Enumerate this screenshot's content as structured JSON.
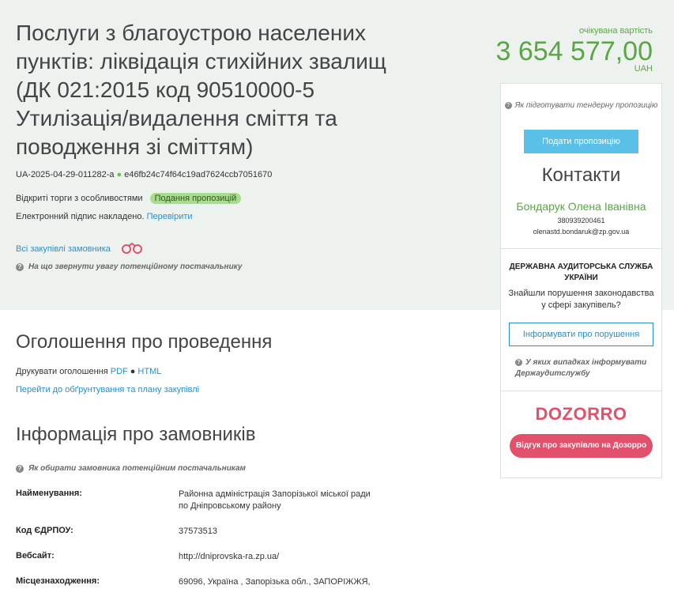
{
  "tender": {
    "title": "Послуги з благоустрою населених пунктів: ліквідація стихійних звалищ (ДК 021:2015 код 90510000-5 Утилізація/видалення сміття та поводження зі сміттям)",
    "id": "UA-2025-04-29-011282-a",
    "hash": "e46fb24c74f64c19ad7624ccb7051670",
    "procedure_type": "Відкриті торги з особливостями",
    "status": "Подання пропозицій",
    "signature_text": "Електронний підпис накладено.",
    "verify_link": "Перевірити",
    "all_purchases_link": "Всі закупівлі замовника",
    "supplier_hint": "На що звернути увагу потенційному постачальнику"
  },
  "price": {
    "label": "очікувана вартість",
    "value": "3 654 577,00",
    "currency": "UAH"
  },
  "sidebar": {
    "prepare_hint": "Як підготувати тендерну пропозицію",
    "submit_button": "Подати пропозицію",
    "contacts_title": "Контакти",
    "contact_name": "Бондарук Олена Іванівна",
    "contact_phone": "380939200461",
    "contact_email": "olenastd.bondaruk@zp.gov.ua",
    "audit_title": "ДЕРЖАВНА АУДИТОРСЬКА СЛУЖБА УКРАЇНИ",
    "audit_text": "Знайшли порушення законодавства у сфері закупівель?",
    "report_button": "Інформувати про порушення",
    "audit_hint": "У яких випадках інформувати Держаудитслужбу",
    "dozorro_logo": "DOZORRO",
    "dozorro_button": "Відгук про закупівлю на Дозорро"
  },
  "announcement": {
    "title": "Оголошення про проведення",
    "print_label": "Друкувати оголошення",
    "pdf_link": "PDF",
    "html_link": "HTML",
    "plan_link": "Перейти до обґрунтування та плану закупівлі"
  },
  "customers": {
    "title": "Інформація про замовників",
    "hint": "Як обирати замовника потенційним постачальникам",
    "rows": [
      {
        "label": "Найменування:",
        "value": "Районна адміністрація Запорізької міської ради по Дніпровському району"
      },
      {
        "label": "Код ЄДРПОУ:",
        "value": "37573513"
      },
      {
        "label": "Вебсайт:",
        "value": "http://dniprovska-ra.zp.ua/"
      },
      {
        "label": "Місцезнаходження:",
        "value": "69096, Україна , Запорізька обл., ЗАПОРІЖЖЯ,"
      }
    ]
  },
  "colors": {
    "accent_green": "#5aa646",
    "link_blue": "#2a8fc7",
    "dozorro_pink": "#e2506b",
    "badge_green": "#a9dc8e"
  }
}
